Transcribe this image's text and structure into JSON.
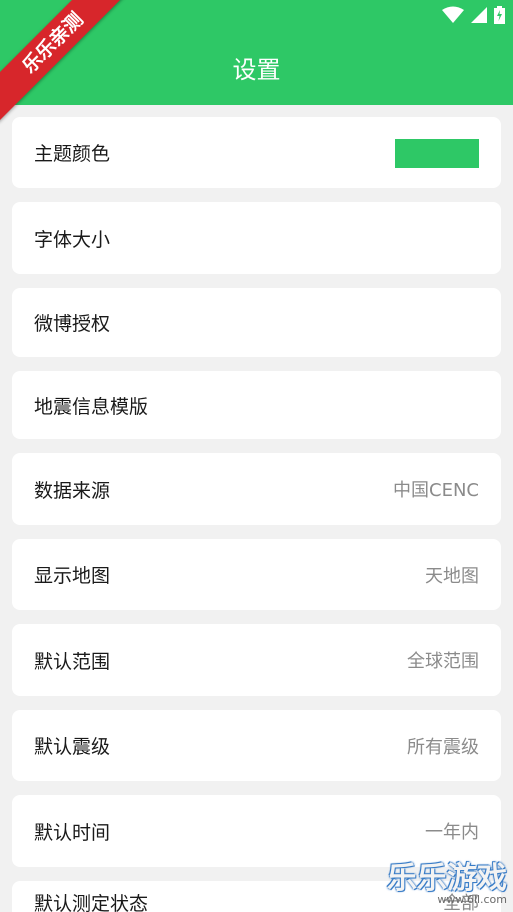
{
  "header": {
    "title": "设置",
    "accent": "#2ec866"
  },
  "ribbon": {
    "text": "乐乐亲测"
  },
  "settings": [
    {
      "label": "主题颜色",
      "value": "",
      "swatch": "#2ec866"
    },
    {
      "label": "字体大小",
      "value": ""
    },
    {
      "label": "微博授权",
      "value": ""
    },
    {
      "label": "地震信息模版",
      "value": ""
    },
    {
      "label": "数据来源",
      "value": "中国CENC"
    },
    {
      "label": "显示地图",
      "value": "天地图"
    },
    {
      "label": "默认范围",
      "value": "全球范围"
    },
    {
      "label": "默认震级",
      "value": "所有震级"
    },
    {
      "label": "默认时间",
      "value": "一年内"
    },
    {
      "label": "默认测定状态",
      "value": "全部"
    }
  ],
  "watermark": {
    "title": "乐乐游戏",
    "site": "www.6ll.com"
  }
}
